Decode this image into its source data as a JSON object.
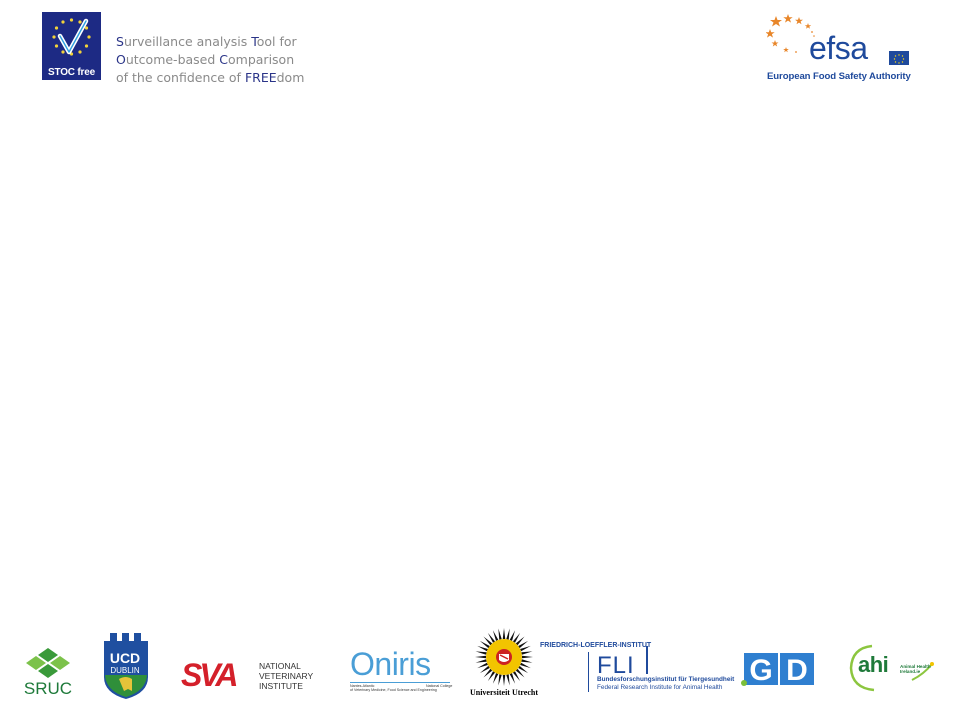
{
  "header": {
    "stoc_logo_label": "STOC free",
    "tagline": [
      {
        "parts": [
          {
            "t": "S",
            "hl": true
          },
          {
            "t": "urveillance analysis ",
            "hl": false
          },
          {
            "t": "T",
            "hl": true
          },
          {
            "t": "ool for",
            "hl": false
          }
        ]
      },
      {
        "parts": [
          {
            "t": "O",
            "hl": true
          },
          {
            "t": "utcome-based ",
            "hl": false
          },
          {
            "t": "C",
            "hl": true
          },
          {
            "t": "omparison",
            "hl": false
          }
        ]
      },
      {
        "parts": [
          {
            "t": "of the confidence of ",
            "hl": false
          },
          {
            "t": "FREE",
            "hl": true
          },
          {
            "t": "dom",
            "hl": false
          }
        ]
      }
    ],
    "efsa_word": "efsa",
    "efsa_name": "European Food Safety Authority"
  },
  "partners": {
    "sruc": "SRUC",
    "ucd_line1": "UCD",
    "ucd_line2": "DUBLIN",
    "sva_mark": "SVA",
    "sva_line1": "NATIONAL",
    "sva_line2": "VETERINARY",
    "sva_line3": "INSTITUTE",
    "oniris_word": "Oniris",
    "oniris_left_1": "Nantes-Atlantic",
    "oniris_left_2": "of Veterinary Medicine, Food Science and Engineering",
    "oniris_right_1": "National College",
    "uu": "Universiteit Utrecht",
    "fli_top": "FRIEDRICH-LOEFFLER-INSTITUT",
    "fli_big": "FLI",
    "fli_line1": "Bundesforschungsinstitut für Tiergesundheit",
    "fli_line2": "Federal Research Institute for Animal Health",
    "gd": "GD",
    "ahi": "ahi",
    "ahi_sub1": "Animal Health",
    "ahi_sub2": "Ireland.ie"
  },
  "colors": {
    "stoc_navy": "#1d2a84",
    "tagline_gray": "#8a8a8a",
    "tagline_highlight": "#2a3488",
    "efsa_blue": "#1f4a9c",
    "efsa_star_orange": "#e8862a",
    "sva_red": "#d4202a",
    "sruc_green": "#1e7a3a",
    "ucd_blue": "#1f4fa0"
  }
}
